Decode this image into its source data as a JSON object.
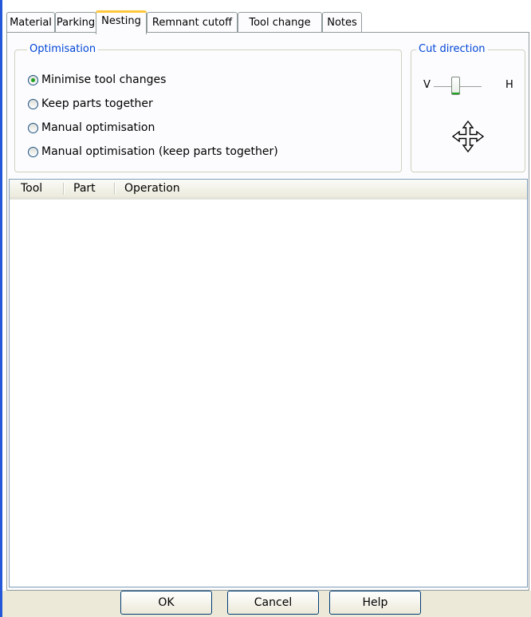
{
  "tabs": [
    {
      "label": "Material",
      "active": false
    },
    {
      "label": "Parking",
      "active": false
    },
    {
      "label": "Nesting",
      "active": true
    },
    {
      "label": "Remnant cutoff",
      "active": false
    },
    {
      "label": "Tool change",
      "active": false
    },
    {
      "label": "Notes",
      "active": false
    }
  ],
  "optimisation": {
    "title": "Optimisation",
    "options": [
      {
        "label": "Minimise tool changes",
        "selected": true
      },
      {
        "label": "Keep parts together",
        "selected": false
      },
      {
        "label": "Manual optimisation",
        "selected": false
      },
      {
        "label": "Manual optimisation (keep parts together)",
        "selected": false
      }
    ]
  },
  "cut_direction": {
    "title": "Cut direction",
    "left_label": "V",
    "right_label": "H",
    "icon": "move-arrows-icon"
  },
  "list": {
    "columns": [
      "Tool",
      "Part",
      "Operation"
    ],
    "rows": []
  },
  "buttons": {
    "ok": "OK",
    "cancel": "Cancel",
    "help": "Help"
  },
  "colors": {
    "group_title": "#0046d5",
    "active_tab_accent": "#ffc83c",
    "radio_dot": "#21a121",
    "window_border": "#2458d8"
  }
}
